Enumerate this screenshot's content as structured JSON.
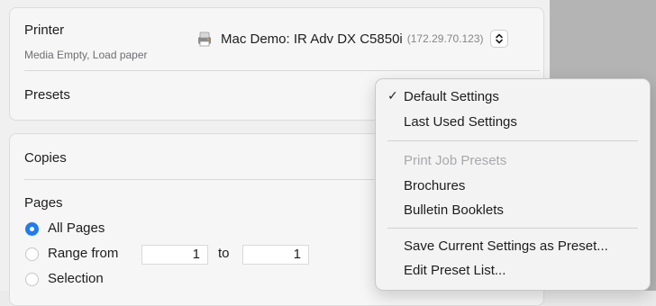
{
  "printer": {
    "label": "Printer",
    "status": "Media Empty, Load paper",
    "name": "Mac Demo: IR Adv DX C5850i",
    "ip": "(172.29.70.123)"
  },
  "presets": {
    "label": "Presets"
  },
  "copies": {
    "label": "Copies"
  },
  "pages": {
    "label": "Pages",
    "options": [
      {
        "label": "All Pages",
        "selected": true
      },
      {
        "label": "Range from",
        "selected": false
      },
      {
        "label": "Selection",
        "selected": false
      }
    ],
    "range_from": "1",
    "range_to_label": "to",
    "range_to": "1"
  },
  "presets_menu": {
    "checkmark": "✓",
    "items": [
      {
        "label": "Default Settings",
        "checked": true,
        "enabled": true
      },
      {
        "label": "Last Used Settings",
        "checked": false,
        "enabled": true
      },
      {
        "label": "Print Job Presets",
        "checked": false,
        "enabled": false
      },
      {
        "label": "Brochures",
        "checked": false,
        "enabled": true
      },
      {
        "label": "Bulletin Booklets",
        "checked": false,
        "enabled": true
      },
      {
        "label": "Save Current Settings as Preset...",
        "checked": false,
        "enabled": true
      },
      {
        "label": "Edit Preset List...",
        "checked": false,
        "enabled": true
      }
    ]
  },
  "colors": {
    "accent": "#1f7cf0",
    "disabled_text": "#a9a9ad"
  }
}
